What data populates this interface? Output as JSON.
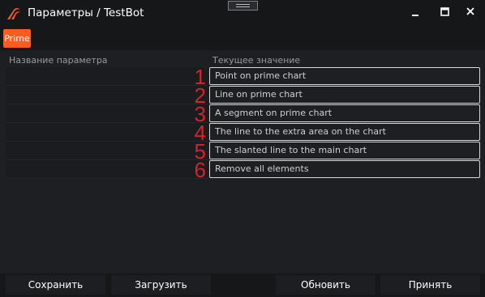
{
  "window": {
    "title": "Параметры / TestBot",
    "logo_icon": "app-logo-icon",
    "controls": [
      "minimize-icon",
      "maximize-icon",
      "close-icon"
    ],
    "accent": "#ff5a1f"
  },
  "tabs": [
    {
      "label": "Prime",
      "active": true
    }
  ],
  "table": {
    "columns": [
      "Название параметра",
      "Текущее значение"
    ],
    "rows": [
      {
        "number": "1",
        "value": "Point on prime chart"
      },
      {
        "number": "2",
        "value": "Line on prime chart"
      },
      {
        "number": "3",
        "value": "A segment on prime chart"
      },
      {
        "number": "4",
        "value": "The line to the extra area on the chart"
      },
      {
        "number": "5",
        "value": "The slanted line to the main chart"
      },
      {
        "number": "6",
        "value": "Remove all elements"
      }
    ],
    "number_color": "#d6222a"
  },
  "buttons": {
    "save": "Сохранить",
    "load": "Загрузить",
    "refresh": "Обновить",
    "accept": "Принять"
  }
}
